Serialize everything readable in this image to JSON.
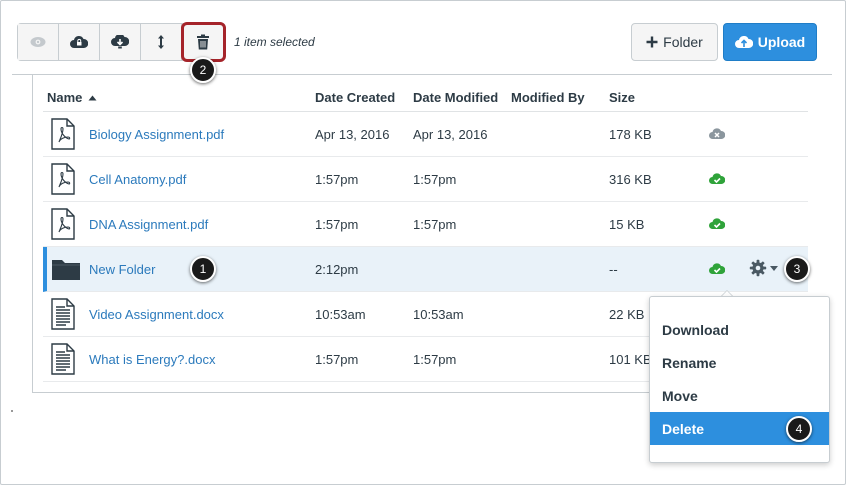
{
  "toolbar": {
    "buttons": [
      {
        "icon": "preview-eye-icon",
        "state": "disabled"
      },
      {
        "icon": "restrict-access-lock-cloud-icon",
        "state": "enabled"
      },
      {
        "icon": "download-cloud-icon",
        "state": "enabled"
      },
      {
        "icon": "move-arrows-icon",
        "state": "enabled"
      },
      {
        "icon": "trash-icon",
        "state": "enabled",
        "highlighted": true
      }
    ],
    "selection_text": "1 item selected",
    "folder_label": "Folder",
    "upload_label": "Upload"
  },
  "table": {
    "headers": {
      "name": "Name",
      "date_created": "Date Created",
      "date_modified": "Date Modified",
      "modified_by": "Modified By",
      "size": "Size"
    },
    "sort": {
      "column": "Name",
      "direction": "ascending"
    },
    "rows": [
      {
        "name": "Biology Assignment.pdf",
        "type": "pdf",
        "date_created": "Apr 13, 2016",
        "date_modified": "Apr 13, 2016",
        "modified_by": "",
        "size": "178 KB",
        "status": "unpublished"
      },
      {
        "name": "Cell Anatomy.pdf",
        "type": "pdf",
        "date_created": "1:57pm",
        "date_modified": "1:57pm",
        "modified_by": "",
        "size": "316 KB",
        "status": "published"
      },
      {
        "name": "DNA Assignment.pdf",
        "type": "pdf",
        "date_created": "1:57pm",
        "date_modified": "1:57pm",
        "modified_by": "",
        "size": "15 KB",
        "status": "published"
      },
      {
        "name": "New Folder",
        "type": "folder",
        "date_created": "2:12pm",
        "date_modified": "",
        "modified_by": "",
        "size": "--",
        "status": "published",
        "selected": true
      },
      {
        "name": "Video Assignment.docx",
        "type": "docx",
        "date_created": "10:53am",
        "date_modified": "10:53am",
        "modified_by": "",
        "size": "22 KB",
        "status": ""
      },
      {
        "name": "What is Energy?.docx",
        "type": "docx",
        "date_created": "1:57pm",
        "date_modified": "1:57pm",
        "modified_by": "",
        "size": "101 KB",
        "status": ""
      }
    ]
  },
  "context_menu": {
    "items": [
      "Download",
      "Rename",
      "Move",
      "Delete"
    ],
    "active": "Delete"
  },
  "callouts": [
    "1",
    "2",
    "3",
    "4"
  ],
  "colors": {
    "accent_blue": "#2d8fde",
    "link_blue": "#2b7abc",
    "published_green": "#2fa33a",
    "unpublished_gray": "#8b969e",
    "delete_highlight": "#a5242a"
  }
}
